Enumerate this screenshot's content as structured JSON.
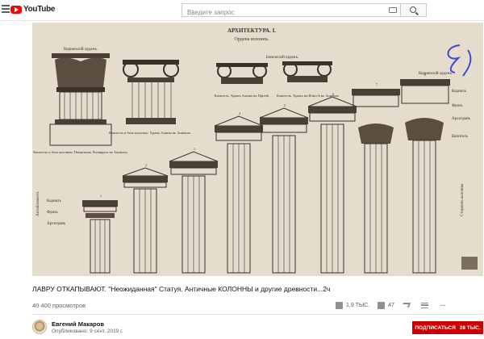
{
  "header": {
    "logo_text": "YouTube",
    "search_placeholder": "Введите запрос"
  },
  "player": {
    "page_heading": "АРХИТЕКТУРА. I.",
    "page_subheading": "Ордена колоннъ.",
    "labels": {
      "corinthian_order_top": "Коринѳскій орденъ.",
      "ionic_order": "Іоническій орденъ.",
      "corinthian_order_right": "Коринѳскій орденъ.",
      "capital_lysicrates": "Капитель и база колонны. Памятникъ Лизикрата въ Аѳинахъ.",
      "capital_erechtheion": "Капитель и база колонны. Храмъ Аѳины въ Аѳинахъ.",
      "capital_priene": "Капитель. Храмъ Аѳины въ Пріенѣ.",
      "capital_ilissos": "Капитель. Храмъ на Илиссѣ въ Аѳинахъ.",
      "karniz_left": "Карнизъ",
      "friz_left": "Фризъ",
      "architrav_left": "Архитравъ",
      "karniz_right": "Карнизъ",
      "friz_right": "Фризъ",
      "architrav_right": "Архитравъ",
      "capital_right": "Капитель",
      "stem_column": "Стержень колонны",
      "entablature": "Антаблементъ"
    },
    "column_numbers": [
      "1",
      "2",
      "3",
      "4",
      "5",
      "6",
      "7",
      "8"
    ],
    "bg_color": "#e6dccd",
    "ink_color": "#3a3129"
  },
  "video": {
    "title": "ЛАВРУ ОТКАПЫВАЮТ. \"Неожиданная\" Статуя. Античные КОЛОННЫ и другие древности...2ч",
    "views": "40 400 просмотров",
    "likes": "1,9 ТЫС.",
    "dislikes": "47",
    "share_label": "",
    "save_label": "",
    "more_label": "···"
  },
  "channel": {
    "name": "Евгений Макаров",
    "published": "Опубликовано: 9 сент. 2019 г.",
    "subscribe_label": "ПОДПИСАТЬСЯ",
    "subscriber_count": "28 ТЫС.",
    "subscribe_color": "#cc0000"
  }
}
